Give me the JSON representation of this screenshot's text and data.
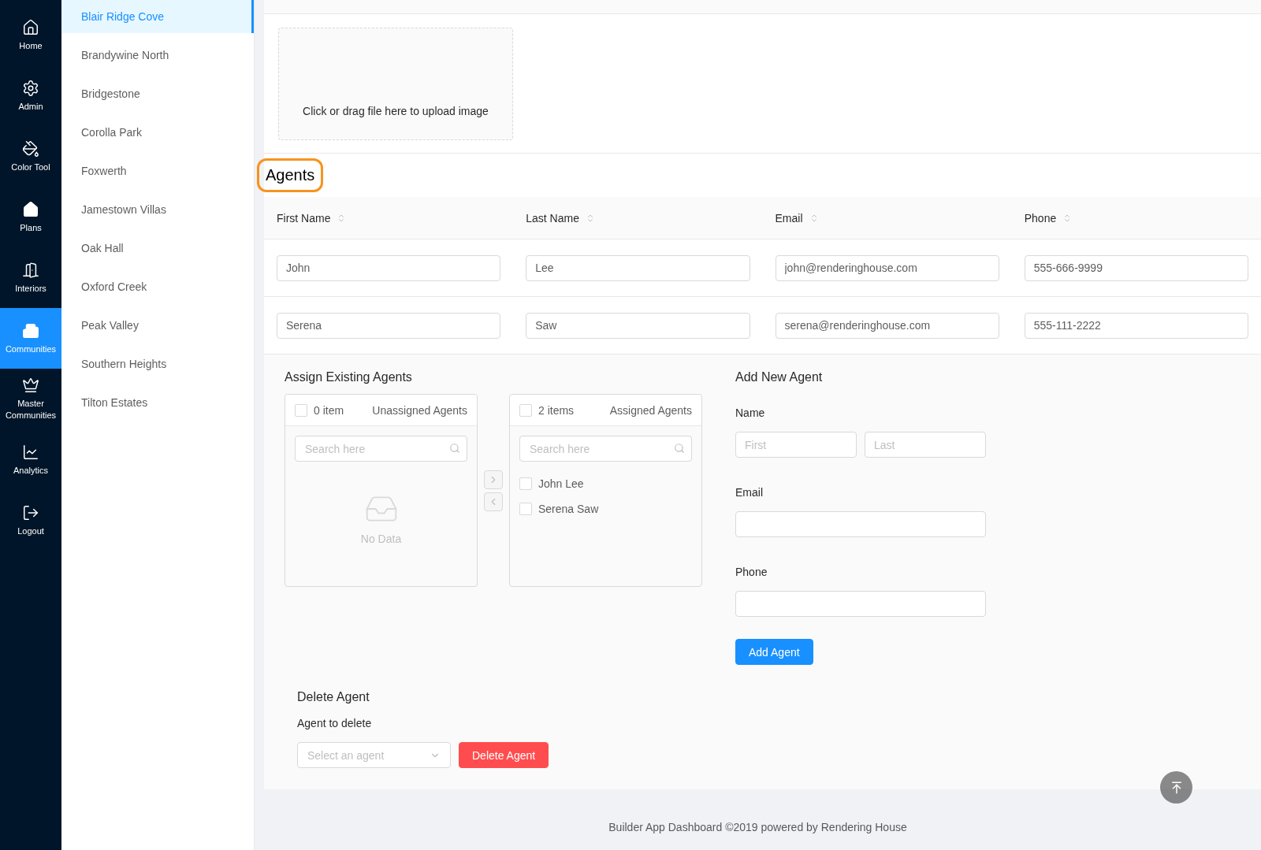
{
  "nav": [
    {
      "label": "Home",
      "selected": false
    },
    {
      "label": "Admin",
      "selected": false
    },
    {
      "label": "Color Tool",
      "selected": false
    },
    {
      "label": "Plans",
      "selected": false
    },
    {
      "label": "Interiors",
      "selected": false
    },
    {
      "label": "Communities",
      "selected": true
    },
    {
      "label": "Master Communities",
      "selected": false
    },
    {
      "label": "Analytics",
      "selected": false
    },
    {
      "label": "Logout",
      "selected": false
    }
  ],
  "communities": [
    {
      "label": "Blair Ridge Cove",
      "selected": true
    },
    {
      "label": "Brandywine North",
      "selected": false
    },
    {
      "label": "Bridgestone",
      "selected": false
    },
    {
      "label": "Corolla Park",
      "selected": false
    },
    {
      "label": "Foxwerth",
      "selected": false
    },
    {
      "label": "Jamestown Villas",
      "selected": false
    },
    {
      "label": "Oak Hall",
      "selected": false
    },
    {
      "label": "Oxford Creek",
      "selected": false
    },
    {
      "label": "Peak Valley",
      "selected": false
    },
    {
      "label": "Southern Heights",
      "selected": false
    },
    {
      "label": "Tilton Estates",
      "selected": false
    }
  ],
  "upload": {
    "text": "Click or drag file here to upload image"
  },
  "agents": {
    "title": "Agents",
    "columns": [
      "First Name",
      "Last Name",
      "Email",
      "Phone"
    ],
    "rows": [
      [
        "John",
        "Lee",
        "john@renderinghouse.com",
        "555-666-9999"
      ],
      [
        "Serena",
        "Saw",
        "serena@renderinghouse.com",
        "555-111-2222"
      ]
    ]
  },
  "assign": {
    "title": "Assign Existing Agents",
    "lists": [
      {
        "count": "0 item",
        "title": "Unassigned Agents",
        "checked": false,
        "search_placeholder": "Search here",
        "empty": "No Data"
      },
      {
        "count": "2 items",
        "title": "Assigned Agents",
        "checked": false,
        "search_placeholder": "Search here",
        "items": [
          {
            "label": "John Lee",
            "checked": false
          },
          {
            "label": "Serena Saw",
            "checked": false
          }
        ]
      }
    ]
  },
  "add_agent": {
    "title": "Add New Agent",
    "name_label": "Name",
    "first_placeholder": "First",
    "last_placeholder": "Last",
    "email_label": "Email",
    "phone_label": "Phone",
    "button": "Add Agent"
  },
  "delete_agent": {
    "title": "Delete Agent",
    "label": "Agent to delete",
    "select_placeholder": "Select an agent",
    "button": "Delete Agent"
  },
  "footer": "Builder App Dashboard ©2019 powered by Rendering House"
}
